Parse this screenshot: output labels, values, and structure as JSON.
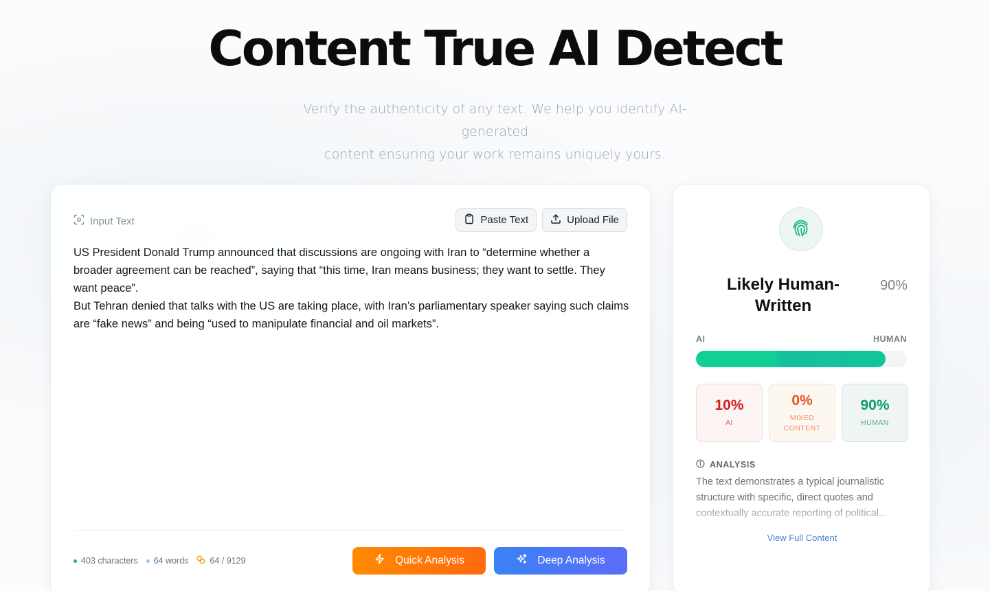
{
  "hero": {
    "title": "Content True AI Detect",
    "subtitle_line1": "Verify the authenticity of any text. We help you identify AI-generated",
    "subtitle_line2": "content ensuring your work remains uniquely yours."
  },
  "input_panel": {
    "label": "Input Text",
    "label_icon": "scan-text-icon",
    "paste_button": {
      "label": "Paste Text",
      "icon": "clipboard-icon"
    },
    "upload_button": {
      "label": "Upload File",
      "icon": "upload-icon"
    },
    "text_paragraphs": [
      "US President Donald Trump announced that discussions are ongoing with Iran to “determine whether a broader agreement can be reached”, saying that “this time, Iran means business; they want to settle. They want peace”.",
      "But Tehran denied that talks with the US are taking place, with Iran’s parliamentary speaker saying such claims are “fake news” and being “used to manipulate financial and oil markets”."
    ],
    "stats": {
      "characters": "403 characters",
      "words": "64 words",
      "tokens": "64 / 9129"
    },
    "quick_button": {
      "label": "Quick Analysis",
      "icon": "lightning-icon"
    },
    "deep_button": {
      "label": "Deep Analysis",
      "icon": "sparkles-icon"
    }
  },
  "result_panel": {
    "icon": "fingerprint-icon",
    "verdict": "Likely Human-Written",
    "verdict_percent": "90%",
    "bar": {
      "left_label": "AI",
      "right_label": "HUMAN",
      "human_fraction": 0.9
    },
    "metrics": {
      "ai": {
        "value": "10%",
        "label": "AI"
      },
      "mixed": {
        "value": "0%",
        "label_line1": "MIXED",
        "label_line2": "CONTENT"
      },
      "human": {
        "value": "90%",
        "label": "HUMAN"
      }
    },
    "analysis_heading": "ANALYSIS",
    "analysis_lines": [
      "The text demonstrates a typical journalistic",
      "structure with specific, direct quotes and",
      "contextually accurate reporting of political..."
    ],
    "view_full_link": "View Full Content"
  },
  "colors": {
    "quick_gradient": [
      "#ff8a00",
      "#ff6a0f"
    ],
    "deep_gradient": [
      "#3b82f6",
      "#5b6cf8"
    ],
    "human_green": "#12cf95",
    "ai_red": "#d11f1f",
    "mixed_orange": "#e8531d",
    "link_blue": "#4c7fd1"
  }
}
